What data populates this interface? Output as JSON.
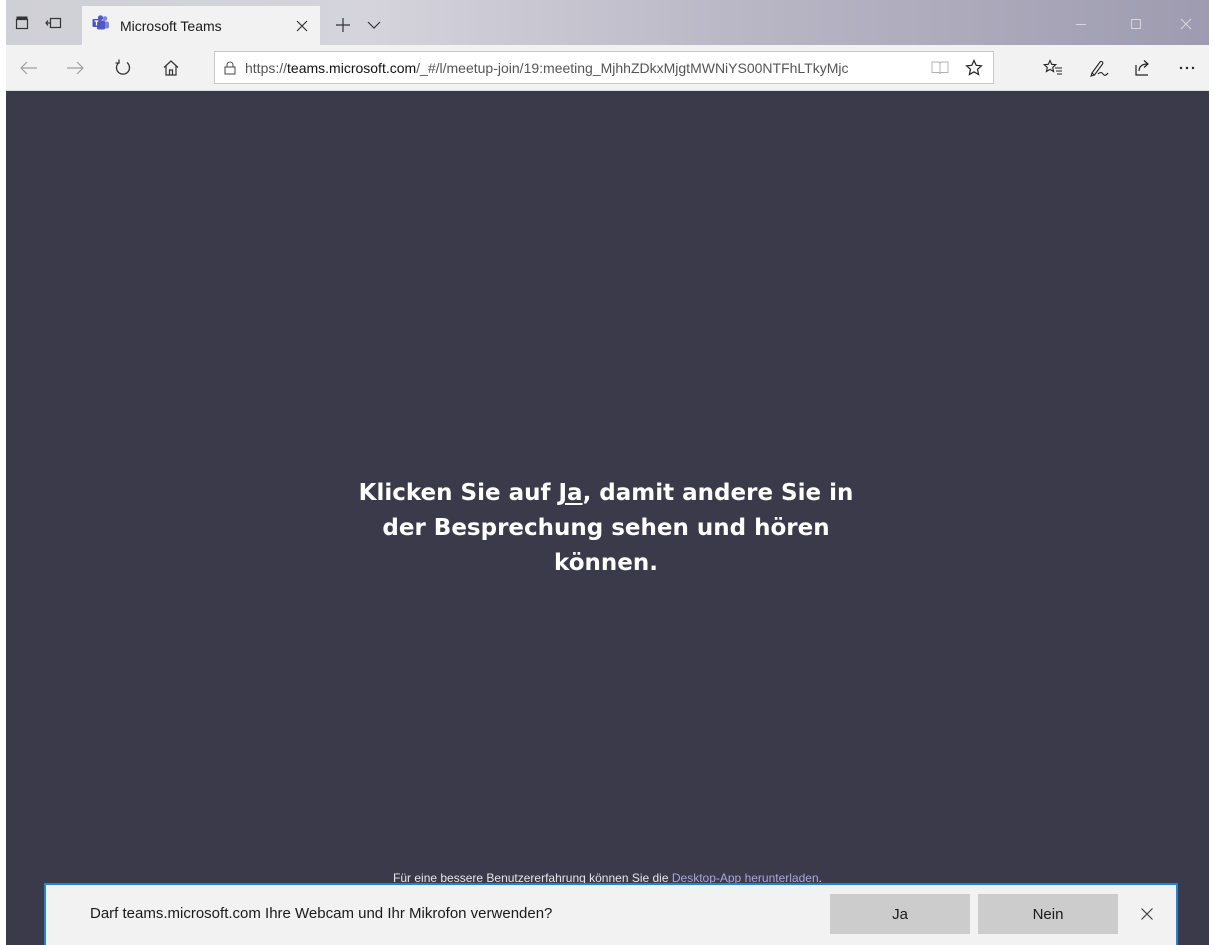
{
  "browser": {
    "tab": {
      "title": "Microsoft Teams"
    },
    "address": {
      "url_prefix": "https://",
      "url_domain": "teams.microsoft.com",
      "url_path": "/_#/l/meetup-join/19:meeting_MjhhZDkxMjgtMWNiYS00NTFhLTkyMjc"
    }
  },
  "page": {
    "prompt": {
      "before": "Klicken Sie auf ",
      "link": "Ja",
      "after": ", damit andere Sie in der Besprechung sehen und hören können."
    },
    "footnote": {
      "text": "Für eine bessere Benutzererfahrung können Sie die ",
      "link": "Desktop-App herunterladen",
      "end": "."
    }
  },
  "permission": {
    "question": "Darf teams.microsoft.com Ihre Webcam und Ihr Mikrofon verwenden?",
    "yes_label": "Ja",
    "no_label": "Nein"
  },
  "colors": {
    "page_bg": "#3b3a4a",
    "accent_border": "#1e86d6",
    "link": "#a6a7dc"
  }
}
